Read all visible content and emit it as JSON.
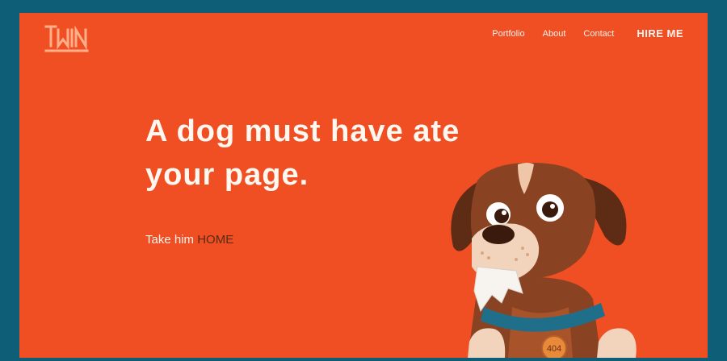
{
  "brand": {
    "logo_text": "TWIN"
  },
  "nav": {
    "items": [
      {
        "label": "Portfolio"
      },
      {
        "label": "About"
      },
      {
        "label": "Contact"
      }
    ],
    "hire_label": "HIRE ME"
  },
  "hero": {
    "headline_line1": "A dog must have ate",
    "headline_line2": "your page.",
    "cta_prefix": "Take him",
    "cta_link": "HOME"
  },
  "illustration": {
    "tag_text": "404"
  },
  "colors": {
    "background": "#f04e23",
    "frame_border": "#0e5e78",
    "text": "#fff8f0",
    "link": "#5a2a14",
    "dog_brown": "#8a4322",
    "collar": "#1f6f8b"
  }
}
